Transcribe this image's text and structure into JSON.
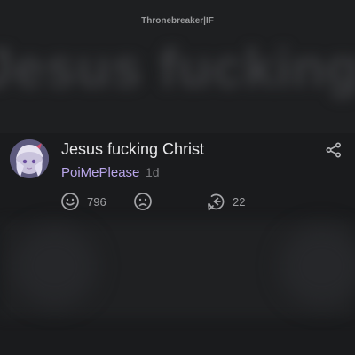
{
  "background": {
    "watermark": "Thronebreaker|IF",
    "blurred_caption": "Jesus fucking Christ"
  },
  "comment": {
    "text": "Jesus fucking Christ",
    "username": "PoiMePlease",
    "age": "1d",
    "likes": "796",
    "replies": "22"
  },
  "icons": {
    "share": "share-icon",
    "like": "smile-icon",
    "dislike": "frown-icon",
    "reply": "reply-icon"
  },
  "colors": {
    "username": "#b9a6ea",
    "text": "#e8e8ea",
    "muted": "#7a7b7e",
    "background": "#1b1c1e"
  }
}
